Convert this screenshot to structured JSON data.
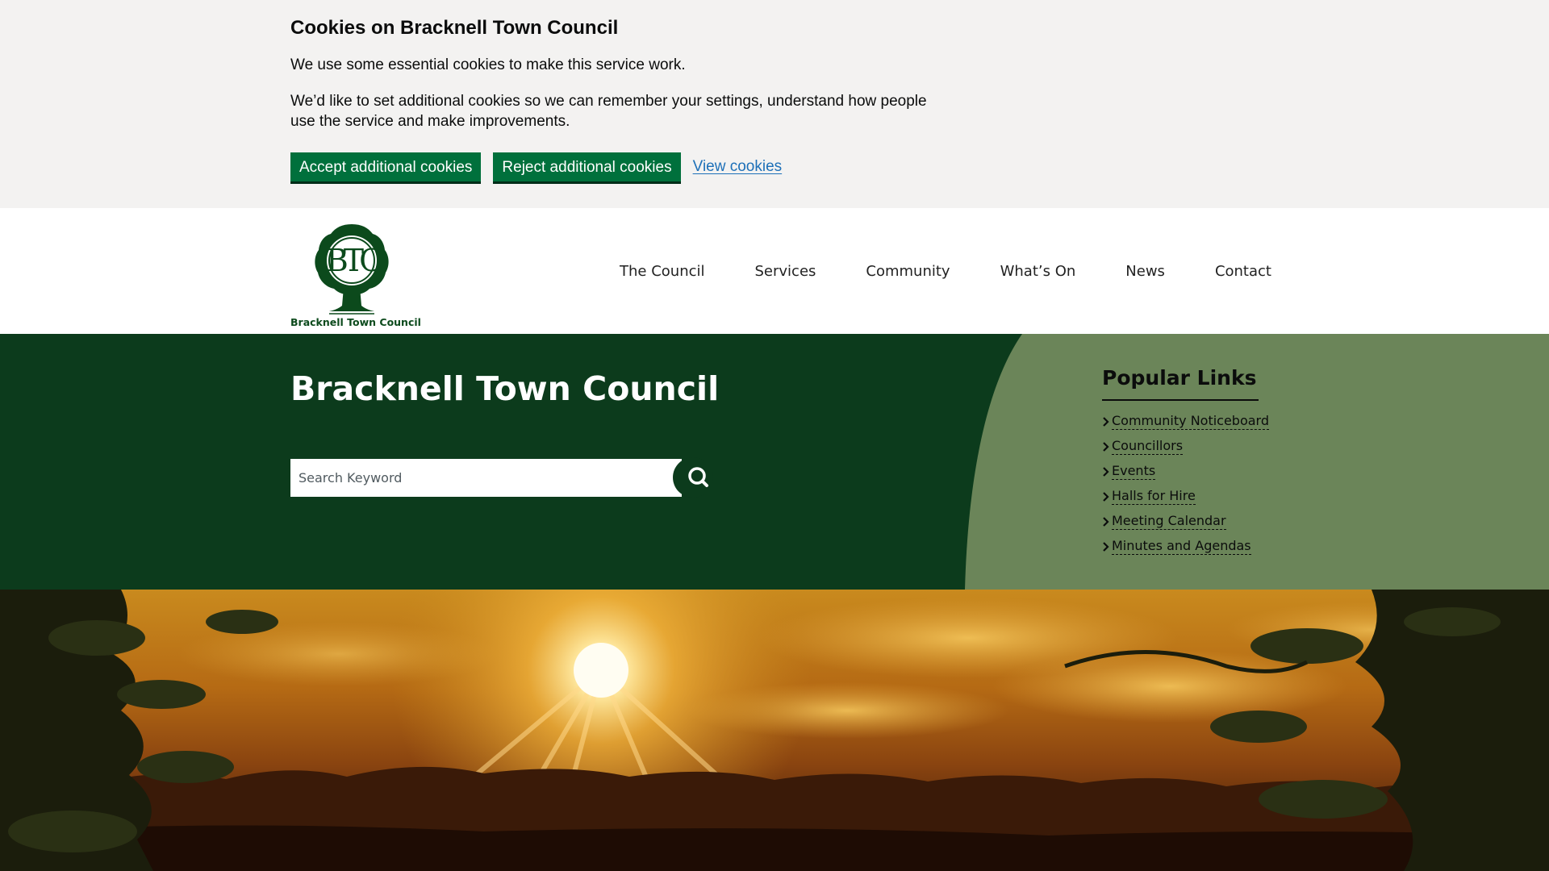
{
  "cookie_banner": {
    "title": "Cookies on Bracknell Town Council",
    "paragraph_1": "We use some essential cookies to make this service work.",
    "paragraph_2": "We’d like to set additional cookies so we can remember your settings, understand how people use the service and make improvements.",
    "accept_label": "Accept additional cookies",
    "reject_label": "Reject additional cookies",
    "view_label": "View cookies"
  },
  "header": {
    "logo_text": "Bracknell Town Council",
    "nav": [
      "The Council",
      "Services",
      "Community",
      "What’s On",
      "News",
      "Contact"
    ]
  },
  "hero": {
    "title": "Bracknell Town Council",
    "search_placeholder": "Search Keyword",
    "popular_title": "Popular Links",
    "popular_links": [
      "Community Noticeboard",
      "Councillors",
      "Events",
      "Halls for Hire",
      "Meeting Calendar",
      "Minutes and Agendas"
    ]
  },
  "icons": {
    "search": "search-icon",
    "chevron": "chevron-right-icon",
    "logo": "tree-logo-icon"
  },
  "colors": {
    "brand_green": "#0c3b1c",
    "panel_green": "#6b8559",
    "button_green": "#00703c",
    "link_blue": "#1d70b8",
    "banner_bg": "#f3f2f1"
  }
}
